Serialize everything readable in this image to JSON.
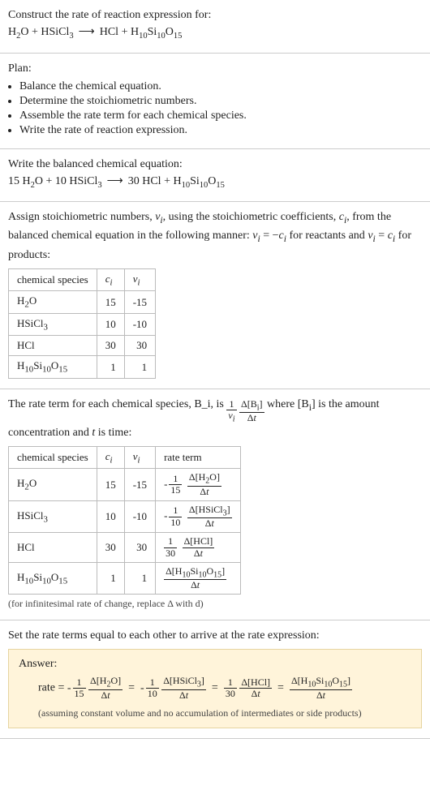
{
  "title": "Construct the rate of reaction expression for:",
  "reaction_unbalanced": "H2O + HSiCl3 ⟶ HCl + H10Si10O15",
  "plan_heading": "Plan:",
  "plan_items": [
    "Balance the chemical equation.",
    "Determine the stoichiometric numbers.",
    "Assemble the rate term for each chemical species.",
    "Write the rate of reaction expression."
  ],
  "balanced_heading": "Write the balanced chemical equation:",
  "balanced_eq": "15 H2O + 10 HSiCl3 ⟶ 30 HCl + H10Si10O15",
  "stoich_text_a": "Assign stoichiometric numbers, ν_i, using the stoichiometric coefficients, c_i, from the balanced chemical equation in the following manner: ν_i = −c_i for reactants and ν_i = c_i for products:",
  "stoich_table": {
    "headers": [
      "chemical species",
      "c_i",
      "ν_i"
    ],
    "rows": [
      {
        "species": "H2O",
        "c": "15",
        "v": "-15"
      },
      {
        "species": "HSiCl3",
        "c": "10",
        "v": "-10"
      },
      {
        "species": "HCl",
        "c": "30",
        "v": "30"
      },
      {
        "species": "H10Si10O15",
        "c": "1",
        "v": "1"
      }
    ]
  },
  "rate_term_text_a": "The rate term for each chemical species, B_i, is ",
  "rate_term_text_b": " where [B_i] is the amount concentration and t is time:",
  "rate_term_frac": {
    "num": "1",
    "den": "ν_i",
    "num2": "Δ[B_i]",
    "den2": "Δt"
  },
  "rate_table": {
    "headers": [
      "chemical species",
      "c_i",
      "ν_i",
      "rate term"
    ],
    "rows": [
      {
        "species": "H2O",
        "c": "15",
        "v": "-15",
        "sign": "-",
        "coef_num": "1",
        "coef_den": "15",
        "d_num": "Δ[H2O]",
        "d_den": "Δt"
      },
      {
        "species": "HSiCl3",
        "c": "10",
        "v": "-10",
        "sign": "-",
        "coef_num": "1",
        "coef_den": "10",
        "d_num": "Δ[HSiCl3]",
        "d_den": "Δt"
      },
      {
        "species": "HCl",
        "c": "30",
        "v": "30",
        "sign": "",
        "coef_num": "1",
        "coef_den": "30",
        "d_num": "Δ[HCl]",
        "d_den": "Δt"
      },
      {
        "species": "H10Si10O15",
        "c": "1",
        "v": "1",
        "sign": "",
        "coef_num": "",
        "coef_den": "",
        "d_num": "Δ[H10Si10O15]",
        "d_den": "Δt"
      }
    ]
  },
  "rate_footnote": "(for infinitesimal rate of change, replace Δ with d)",
  "set_equal_text": "Set the rate terms equal to each other to arrive at the rate expression:",
  "answer_label": "Answer:",
  "answer_rate_prefix": "rate = ",
  "answer_terms": [
    {
      "sign": "-",
      "coef_num": "1",
      "coef_den": "15",
      "d_num": "Δ[H2O]",
      "d_den": "Δt"
    },
    {
      "sign": "-",
      "coef_num": "1",
      "coef_den": "10",
      "d_num": "Δ[HSiCl3]",
      "d_den": "Δt"
    },
    {
      "sign": "",
      "coef_num": "1",
      "coef_den": "30",
      "d_num": "Δ[HCl]",
      "d_den": "Δt"
    },
    {
      "sign": "",
      "coef_num": "",
      "coef_den": "",
      "d_num": "Δ[H10Si10O15]",
      "d_den": "Δt"
    }
  ],
  "answer_footnote": "(assuming constant volume and no accumulation of intermediates or side products)"
}
